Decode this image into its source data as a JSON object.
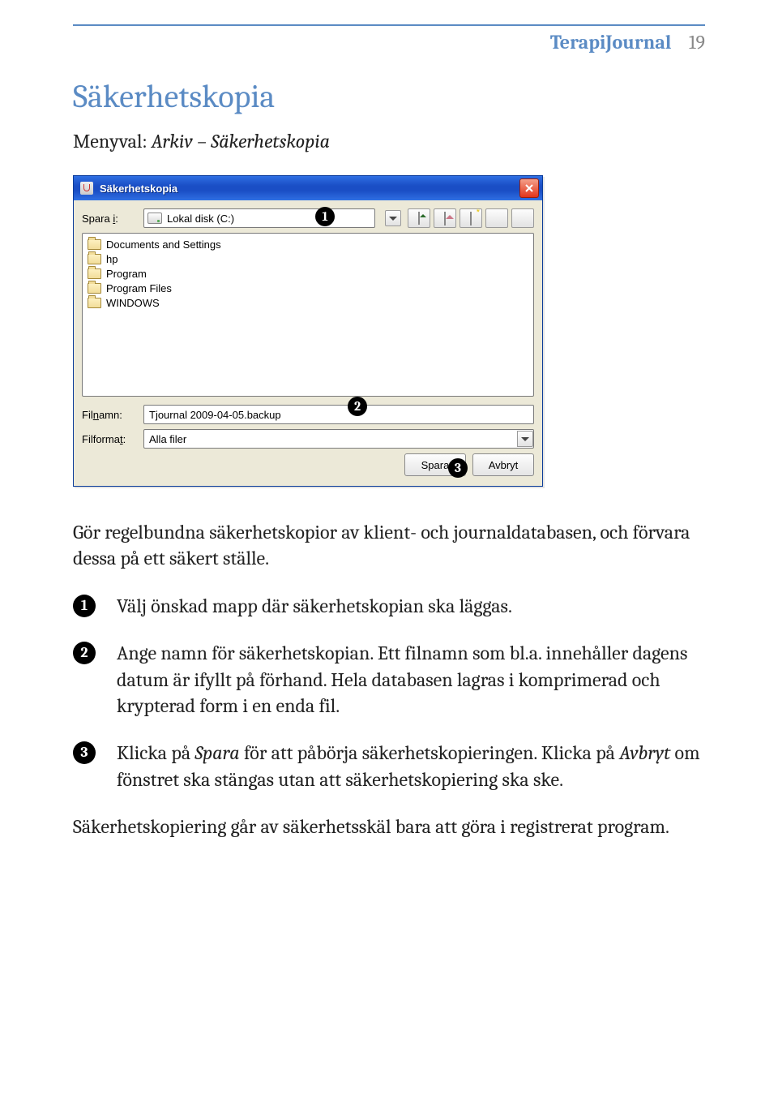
{
  "header": {
    "title": "TerapiJournal",
    "page": "19"
  },
  "section_title": "Säkerhetskopia",
  "menupath": {
    "label": "Menyval: ",
    "path": "Arkiv – Säkerhetskopia"
  },
  "dialog": {
    "title": "Säkerhetskopia",
    "save_in_label_pre": "Spara ",
    "save_in_label_ul": "i",
    "save_in_label_post": ":",
    "drive": "Lokal disk (C:)",
    "folders": [
      "Documents and Settings",
      "hp",
      "Program",
      "Program Files",
      "WINDOWS"
    ],
    "filename_label_pre": "Fil",
    "filename_label_ul": "n",
    "filename_label_post": "amn:",
    "filename_value": "Tjournal 2009-04-05.backup",
    "format_label_pre": "Filforma",
    "format_label_ul": "t",
    "format_label_post": ":",
    "format_value": "Alla filer",
    "btn_save": "Spara",
    "btn_cancel": "Avbryt"
  },
  "badges": {
    "b1": "1",
    "b2": "2",
    "b3": "3"
  },
  "intro": "Gör regelbundna säkerhetskopior av klient- och journaldatabasen, och förvara dessa på ett säkert ställe.",
  "steps": {
    "s1": "Välj önskad mapp där säkerhetskopian ska läggas.",
    "s2": "Ange namn för säkerhetskopian. Ett filnamn som bl.a. innehåller dagens datum är ifyllt på förhand. Hela databasen lagras i komprimerad och krypterad form i en enda fil.",
    "s3_a": "Klicka på ",
    "s3_spara": "Spara",
    "s3_b": " för att påbörja säkerhetskopieringen. Klicka på ",
    "s3_avbryt": "Avbryt",
    "s3_c": " om fönstret ska stängas utan att säkerhetskopiering ska ske."
  },
  "footer_note": "Säkerhetskopiering går av säkerhetsskäl bara att göra i registrerat program."
}
